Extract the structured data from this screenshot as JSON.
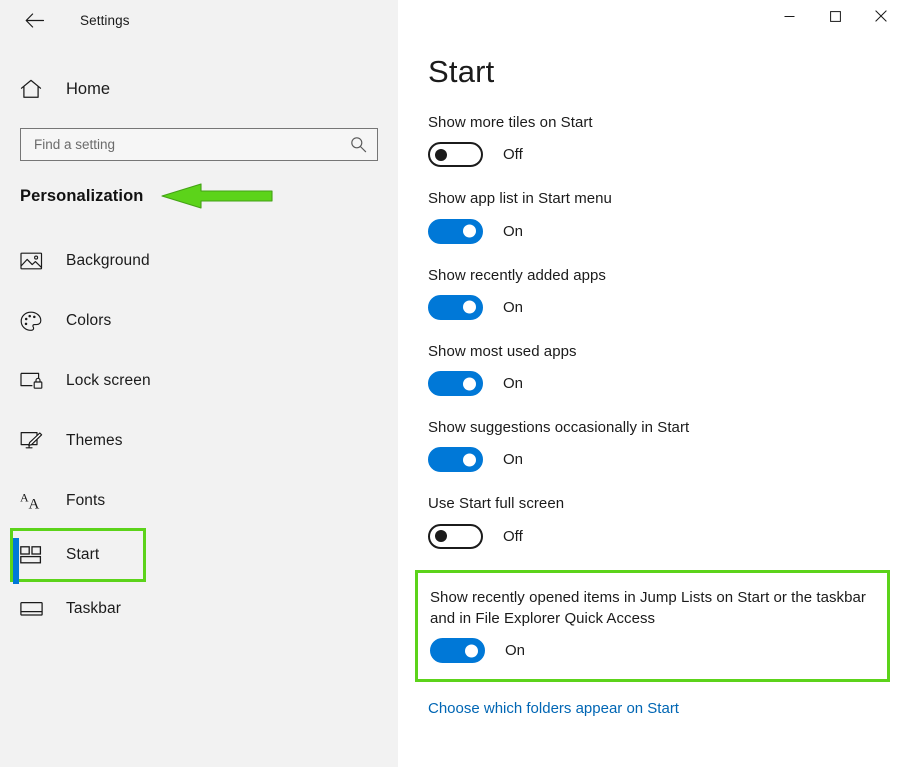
{
  "window": {
    "app_title": "Settings",
    "back_label": "Back",
    "controls": {
      "minimize": "Minimize",
      "maximize": "Maximize",
      "close": "Close"
    }
  },
  "sidebar": {
    "home_label": "Home",
    "search": {
      "placeholder": "Find a setting",
      "value": "",
      "icon": "search-icon"
    },
    "category_title": "Personalization",
    "pointer_arrow": {
      "icon": "left-arrow-annotation",
      "color": "#5cd31a",
      "direction": "left"
    },
    "items": [
      {
        "label": "Background",
        "icon": "image-icon",
        "selected": false,
        "highlighted": false
      },
      {
        "label": "Colors",
        "icon": "palette-icon",
        "selected": false,
        "highlighted": false
      },
      {
        "label": "Lock screen",
        "icon": "lockscreen-icon",
        "selected": false,
        "highlighted": false
      },
      {
        "label": "Themes",
        "icon": "themes-icon",
        "selected": false,
        "highlighted": false
      },
      {
        "label": "Fonts",
        "icon": "fonts-icon",
        "selected": false,
        "highlighted": false
      },
      {
        "label": "Start",
        "icon": "start-tiles-icon",
        "selected": true,
        "highlighted": true
      },
      {
        "label": "Taskbar",
        "icon": "taskbar-icon",
        "selected": false,
        "highlighted": false
      }
    ]
  },
  "main": {
    "page_title": "Start",
    "settings": [
      {
        "label": "Show more tiles on Start",
        "state": "Off",
        "on": false,
        "highlighted": false
      },
      {
        "label": "Show app list in Start menu",
        "state": "On",
        "on": true,
        "highlighted": false
      },
      {
        "label": "Show recently added apps",
        "state": "On",
        "on": true,
        "highlighted": false
      },
      {
        "label": "Show most used apps",
        "state": "On",
        "on": true,
        "highlighted": false
      },
      {
        "label": "Show suggestions occasionally in Start",
        "state": "On",
        "on": true,
        "highlighted": false
      },
      {
        "label": "Use Start full screen",
        "state": "Off",
        "on": false,
        "highlighted": false
      },
      {
        "label": "Show recently opened items in Jump Lists on Start or the taskbar and in File Explorer Quick Access",
        "state": "On",
        "on": true,
        "highlighted": true
      }
    ],
    "folders_link": "Choose which folders appear on Start"
  },
  "colors": {
    "accent_blue": "#0078d7",
    "link_blue": "#0066b4",
    "highlight_green": "#5cd31a",
    "sidebar_bg": "#f2f2f2",
    "main_bg": "#ffffff",
    "text": "#1b1b1b"
  }
}
